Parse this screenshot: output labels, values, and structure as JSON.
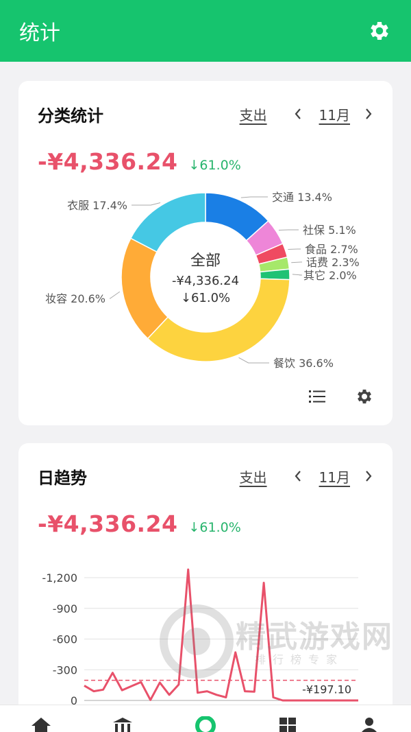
{
  "appbar": {
    "title": "统计",
    "icon": "gear-icon"
  },
  "category_card": {
    "title": "分类统计",
    "type_label": "支出",
    "month": "11月",
    "amount": "-¥4,336.24",
    "change": "↓61.0%",
    "center": {
      "label": "全部",
      "amount": "-¥4,336.24",
      "change": "↓61.0%"
    }
  },
  "trend_card": {
    "title": "日趋势",
    "type_label": "支出",
    "month": "11月",
    "amount": "-¥4,336.24",
    "change": "↓61.0%"
  },
  "watermark": {
    "title": "精武游戏网",
    "subtitle": "排行榜专家"
  },
  "colors": {
    "accent": "#16c46e",
    "negative": "#e8516a",
    "positive": "#27b46c"
  },
  "chart_data": [
    {
      "type": "pie",
      "slices": [
        {
          "name": "交通",
          "percent": 13.4,
          "label": "交通 13.4%",
          "color": "#1a7fe5"
        },
        {
          "name": "社保",
          "percent": 5.1,
          "label": "社保 5.1%",
          "color": "#ee86d8"
        },
        {
          "name": "食品",
          "percent": 2.7,
          "label": "食品 2.7%",
          "color": "#ef4a61"
        },
        {
          "name": "话费",
          "percent": 2.3,
          "label": "话费 2.3%",
          "color": "#a6e86a"
        },
        {
          "name": "其它",
          "percent": 2.0,
          "label": "其它 2.0%",
          "color": "#1fc274"
        },
        {
          "name": "餐饮",
          "percent": 36.6,
          "label": "餐饮 36.6%",
          "color": "#fdd33f"
        },
        {
          "name": "妆容",
          "percent": 20.6,
          "label": "妆容 20.6%",
          "color": "#ffab37"
        },
        {
          "name": "衣服",
          "percent": 17.4,
          "label": "衣服 17.4%",
          "color": "#45c8e4"
        }
      ]
    },
    {
      "type": "line",
      "y_ticks": [
        -1200,
        -900,
        -600,
        -300,
        0
      ],
      "y_tick_labels": [
        "-1,200",
        "-900",
        "-600",
        "-300",
        "0"
      ],
      "ylim": [
        0,
        1200
      ],
      "x": [
        1,
        2,
        3,
        4,
        5,
        6,
        7,
        8,
        9,
        10,
        11,
        12,
        13,
        14,
        15,
        16,
        17,
        18,
        19,
        20,
        21,
        22,
        23,
        24,
        25,
        26,
        27,
        28,
        29,
        30
      ],
      "values": [
        145,
        90,
        105,
        270,
        100,
        140,
        180,
        5,
        175,
        55,
        155,
        1280,
        75,
        90,
        55,
        30,
        470,
        90,
        85,
        1150,
        30,
        0,
        0,
        0,
        0,
        0,
        0,
        0,
        0,
        0
      ],
      "average": 197.1,
      "average_label": "-¥197.10",
      "color": "#e8516a"
    }
  ]
}
